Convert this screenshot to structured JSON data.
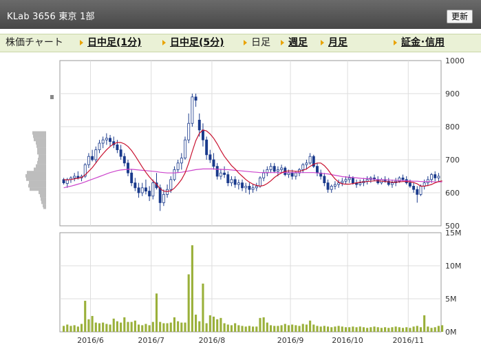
{
  "header": {
    "title": "KLab 3656 東京 1部",
    "update_label": "更新"
  },
  "tabs": [
    {
      "label": "株価チャート",
      "link": false
    },
    {
      "label": "日中足(1分)",
      "link": true
    },
    {
      "label": "日中足(5分)",
      "link": true
    },
    {
      "label": "日足",
      "link": false
    },
    {
      "label": "週足",
      "link": true
    },
    {
      "label": "月足",
      "link": true
    },
    {
      "label": "証金･信用",
      "link": true
    }
  ],
  "chart_data": {
    "type": "candlestick",
    "price_axis": {
      "ticks": [
        "1000",
        "900",
        "800",
        "700",
        "600",
        "500"
      ],
      "range": [
        500,
        1000
      ]
    },
    "volume_axis": {
      "ticks": [
        "15M",
        "10M",
        "5M",
        "0M"
      ],
      "range": [
        0,
        15
      ]
    },
    "x_tick_labels": [
      "2016/6",
      "2016/7",
      "2016/8",
      "2016/9",
      "2016/10",
      "2016/11"
    ],
    "colors": {
      "up_candle": "#ffffff",
      "down_candle": "#1a3a8c",
      "ma_short": "#c8102e",
      "ma_long": "#cc44cc",
      "volume": "#9ab03a",
      "volume_profile": "#bdbdbd",
      "grid": "#dddddd"
    },
    "ohlc": [
      [
        640,
        645,
        625,
        630
      ],
      [
        628,
        645,
        615,
        640
      ],
      [
        640,
        650,
        630,
        645
      ],
      [
        645,
        660,
        635,
        650
      ],
      [
        650,
        665,
        640,
        645
      ],
      [
        645,
        655,
        635,
        650
      ],
      [
        650,
        690,
        645,
        685
      ],
      [
        685,
        720,
        675,
        710
      ],
      [
        710,
        730,
        695,
        700
      ],
      [
        700,
        740,
        690,
        730
      ],
      [
        730,
        760,
        720,
        750
      ],
      [
        750,
        770,
        735,
        760
      ],
      [
        760,
        780,
        745,
        765
      ],
      [
        765,
        775,
        740,
        755
      ],
      [
        755,
        770,
        735,
        745
      ],
      [
        745,
        760,
        720,
        730
      ],
      [
        730,
        745,
        700,
        710
      ],
      [
        710,
        720,
        680,
        690
      ],
      [
        690,
        700,
        650,
        660
      ],
      [
        660,
        670,
        620,
        630
      ],
      [
        630,
        645,
        605,
        615
      ],
      [
        615,
        630,
        585,
        600
      ],
      [
        600,
        630,
        590,
        615
      ],
      [
        615,
        640,
        595,
        605
      ],
      [
        605,
        620,
        575,
        590
      ],
      [
        590,
        640,
        580,
        630
      ],
      [
        630,
        660,
        610,
        615
      ],
      [
        615,
        625,
        545,
        570
      ],
      [
        570,
        610,
        560,
        595
      ],
      [
        595,
        625,
        585,
        610
      ],
      [
        610,
        650,
        600,
        640
      ],
      [
        640,
        680,
        635,
        670
      ],
      [
        670,
        700,
        660,
        690
      ],
      [
        690,
        720,
        670,
        705
      ],
      [
        705,
        770,
        700,
        760
      ],
      [
        760,
        840,
        750,
        810
      ],
      [
        810,
        900,
        800,
        890
      ],
      [
        890,
        900,
        860,
        880
      ],
      [
        820,
        840,
        770,
        790
      ],
      [
        790,
        810,
        740,
        760
      ],
      [
        760,
        770,
        700,
        715
      ],
      [
        715,
        730,
        690,
        700
      ],
      [
        700,
        720,
        670,
        680
      ],
      [
        680,
        690,
        640,
        650
      ],
      [
        650,
        670,
        640,
        660
      ],
      [
        660,
        680,
        645,
        655
      ],
      [
        655,
        665,
        620,
        630
      ],
      [
        630,
        650,
        620,
        640
      ],
      [
        640,
        650,
        615,
        625
      ],
      [
        625,
        640,
        610,
        630
      ],
      [
        630,
        640,
        605,
        615
      ],
      [
        615,
        630,
        600,
        620
      ],
      [
        620,
        630,
        595,
        610
      ],
      [
        610,
        625,
        600,
        615
      ],
      [
        615,
        630,
        605,
        620
      ],
      [
        620,
        650,
        615,
        645
      ],
      [
        645,
        670,
        635,
        660
      ],
      [
        660,
        680,
        650,
        670
      ],
      [
        670,
        690,
        660,
        680
      ],
      [
        680,
        690,
        660,
        665
      ],
      [
        665,
        680,
        650,
        670
      ],
      [
        670,
        685,
        660,
        675
      ],
      [
        675,
        680,
        650,
        655
      ],
      [
        655,
        670,
        645,
        660
      ],
      [
        660,
        670,
        640,
        650
      ],
      [
        650,
        665,
        640,
        660
      ],
      [
        660,
        675,
        650,
        670
      ],
      [
        670,
        690,
        660,
        685
      ],
      [
        685,
        700,
        670,
        690
      ],
      [
        690,
        720,
        685,
        710
      ],
      [
        710,
        715,
        675,
        680
      ],
      [
        680,
        690,
        650,
        660
      ],
      [
        660,
        670,
        640,
        650
      ],
      [
        650,
        660,
        620,
        630
      ],
      [
        630,
        640,
        600,
        610
      ],
      [
        610,
        625,
        600,
        620
      ],
      [
        620,
        635,
        610,
        625
      ],
      [
        625,
        640,
        615,
        630
      ],
      [
        630,
        645,
        620,
        635
      ],
      [
        635,
        650,
        625,
        640
      ],
      [
        640,
        655,
        630,
        645
      ],
      [
        645,
        650,
        625,
        630
      ],
      [
        630,
        640,
        615,
        625
      ],
      [
        625,
        640,
        620,
        630
      ],
      [
        630,
        645,
        620,
        635
      ],
      [
        635,
        650,
        625,
        640
      ],
      [
        640,
        650,
        630,
        645
      ],
      [
        645,
        655,
        635,
        640
      ],
      [
        640,
        650,
        625,
        630
      ],
      [
        630,
        645,
        625,
        640
      ],
      [
        640,
        650,
        630,
        635
      ],
      [
        635,
        645,
        620,
        625
      ],
      [
        625,
        640,
        615,
        630
      ],
      [
        630,
        645,
        620,
        635
      ],
      [
        635,
        650,
        630,
        645
      ],
      [
        645,
        655,
        635,
        640
      ],
      [
        640,
        650,
        625,
        630
      ],
      [
        630,
        640,
        615,
        620
      ],
      [
        620,
        630,
        600,
        610
      ],
      [
        610,
        620,
        570,
        595
      ],
      [
        595,
        625,
        590,
        620
      ],
      [
        620,
        640,
        610,
        630
      ],
      [
        630,
        650,
        620,
        640
      ],
      [
        640,
        660,
        630,
        655
      ],
      [
        655,
        665,
        635,
        645
      ],
      [
        645,
        660,
        635,
        650
      ]
    ],
    "ma_short": [
      640,
      639,
      640,
      642,
      644,
      646,
      654,
      665,
      676,
      690,
      705,
      718,
      730,
      740,
      748,
      752,
      752,
      748,
      740,
      728,
      712,
      695,
      678,
      662,
      648,
      636,
      626,
      612,
      605,
      604,
      606,
      614,
      626,
      640,
      660,
      690,
      725,
      758,
      780,
      790,
      787,
      778,
      765,
      748,
      728,
      710,
      696,
      682,
      672,
      660,
      650,
      640,
      632,
      626,
      622,
      620,
      622,
      628,
      636,
      646,
      654,
      660,
      665,
      666,
      666,
      665,
      665,
      668,
      672,
      680,
      686,
      690,
      690,
      682,
      670,
      655,
      642,
      632,
      627,
      626,
      626,
      628,
      630,
      632,
      633,
      634,
      635,
      636,
      636,
      635,
      634,
      633,
      632,
      632,
      633,
      634,
      634,
      633,
      631,
      627,
      620,
      620,
      622,
      625,
      630,
      634,
      636
    ],
    "ma_long": [
      615,
      618,
      620,
      623,
      626,
      629,
      633,
      637,
      641,
      645,
      649,
      653,
      657,
      661,
      664,
      667,
      669,
      670,
      671,
      671,
      670,
      669,
      668,
      667,
      666,
      665,
      664,
      662,
      661,
      660,
      660,
      660,
      661,
      662,
      664,
      666,
      668,
      670,
      671,
      672,
      672,
      672,
      672,
      671,
      671,
      670,
      670,
      669,
      668,
      667,
      666,
      665,
      664,
      663,
      662,
      661,
      661,
      661,
      661,
      661,
      661,
      661,
      661,
      661,
      661,
      661,
      661,
      661,
      661,
      661,
      661,
      660,
      659,
      658,
      657,
      655,
      653,
      651,
      649,
      648,
      647,
      646,
      645,
      644,
      643,
      643,
      642,
      641,
      640,
      640,
      639,
      639,
      638,
      638,
      637,
      637,
      636,
      636,
      635,
      635,
      634,
      634,
      634,
      634,
      633,
      633,
      633
    ],
    "volume_m": [
      0.9,
      1.1,
      0.9,
      1.0,
      0.8,
      1.2,
      4.7,
      1.9,
      2.4,
      1.4,
      1.3,
      1.4,
      1.2,
      1.1,
      2.0,
      1.6,
      1.4,
      2.2,
      1.5,
      1.5,
      1.7,
      1.1,
      1.0,
      1.2,
      1.0,
      1.5,
      5.8,
      1.5,
      1.3,
      1.3,
      1.4,
      2.2,
      1.6,
      1.4,
      1.4,
      8.7,
      13.1,
      2.6,
      1.6,
      7.3,
      1.3,
      2.5,
      2.3,
      1.9,
      2.1,
      1.3,
      1.1,
      1.0,
      1.3,
      1.0,
      0.9,
      0.8,
      0.9,
      0.8,
      0.8,
      2.1,
      2.2,
      1.4,
      1.0,
      0.9,
      0.9,
      1.0,
      1.2,
      1.0,
      1.1,
      1.0,
      0.9,
      1.2,
      1.1,
      1.7,
      1.1,
      0.9,
      0.8,
      0.9,
      0.8,
      0.7,
      0.8,
      0.9,
      0.8,
      0.7,
      0.7,
      0.8,
      0.7,
      0.8,
      0.7,
      0.6,
      0.7,
      0.8,
      0.7,
      0.6,
      0.7,
      0.6,
      0.7,
      0.8,
      0.7,
      0.6,
      0.7,
      0.6,
      0.8,
      0.9,
      0.7,
      2.5,
      0.8,
      0.6,
      0.7,
      0.9,
      1.0
    ],
    "volume_profile": [
      [
        780,
        40
      ],
      [
        770,
        38
      ],
      [
        760,
        36
      ],
      [
        750,
        30
      ],
      [
        740,
        28
      ],
      [
        730,
        26
      ],
      [
        720,
        26
      ],
      [
        710,
        22
      ],
      [
        700,
        24
      ],
      [
        690,
        26
      ],
      [
        680,
        30
      ],
      [
        670,
        36
      ],
      [
        660,
        56
      ],
      [
        650,
        60
      ],
      [
        640,
        58
      ],
      [
        630,
        50
      ],
      [
        620,
        52
      ],
      [
        610,
        48
      ],
      [
        600,
        22
      ],
      [
        590,
        18
      ],
      [
        580,
        16
      ],
      [
        570,
        14
      ],
      [
        560,
        10
      ],
      [
        555,
        8
      ]
    ]
  }
}
